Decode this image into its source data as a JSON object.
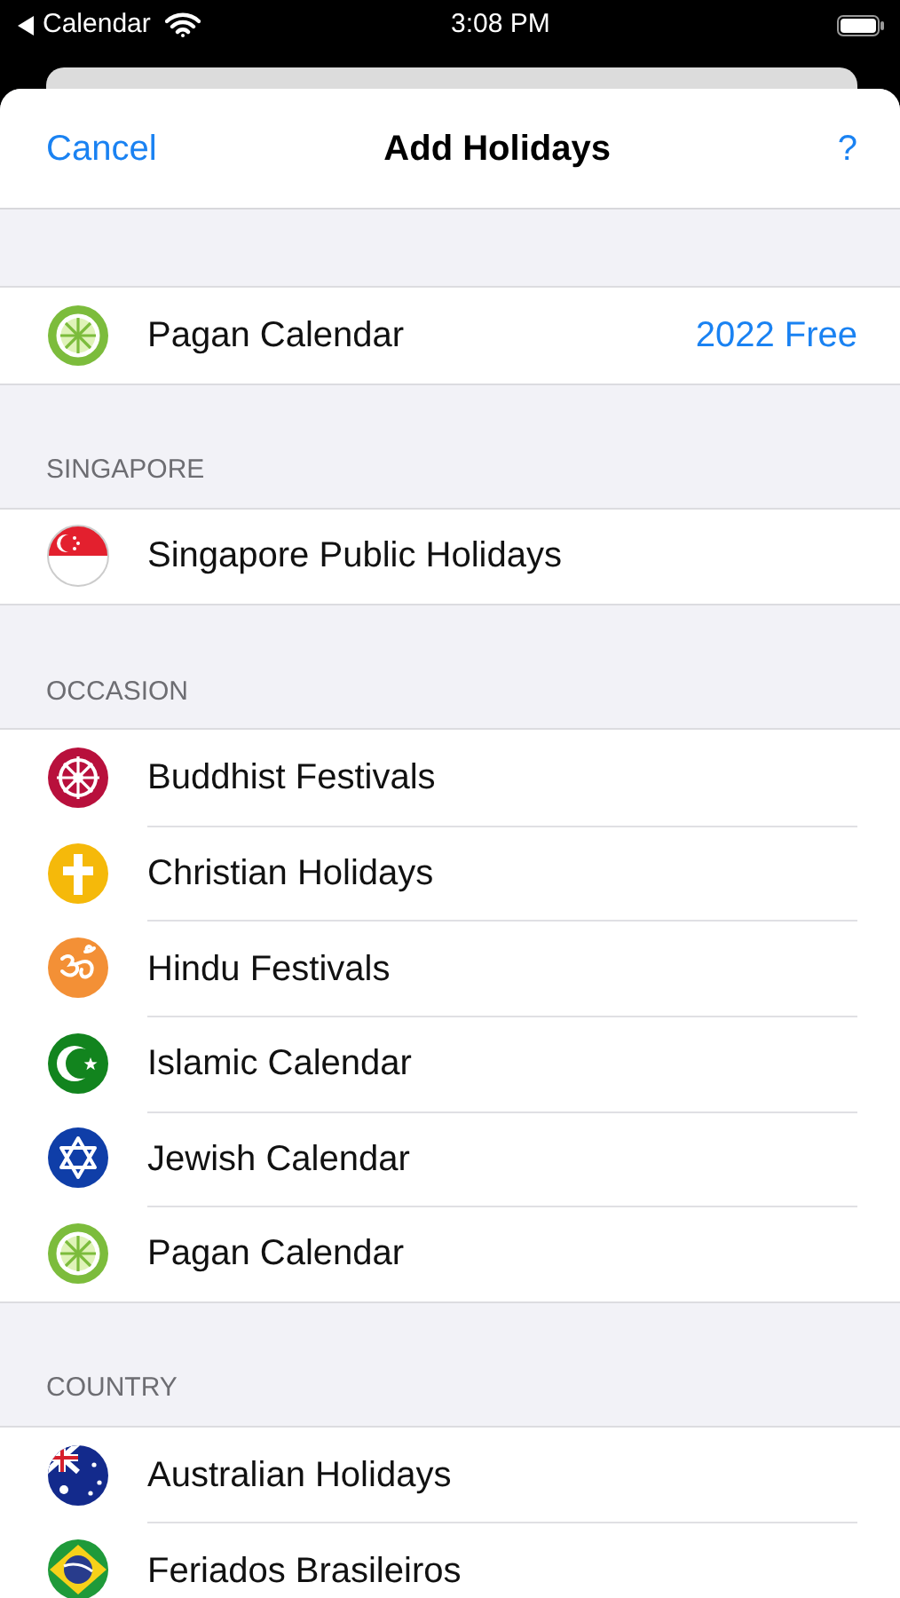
{
  "status_bar": {
    "back_app": "Calendar",
    "time": "3:08 PM"
  },
  "nav": {
    "cancel": "Cancel",
    "title": "Add Holidays",
    "help": "?"
  },
  "sections": [
    {
      "rows": [
        {
          "kind": "pagan",
          "label": "Pagan Calendar",
          "detail": "2022 Free"
        }
      ]
    },
    {
      "header": "SINGAPORE",
      "rows": [
        {
          "kind": "flag-sg",
          "label": "Singapore Public Holidays"
        }
      ]
    },
    {
      "header": "OCCASION",
      "rows": [
        {
          "kind": "dharma",
          "label": "Buddhist Festivals"
        },
        {
          "kind": "cross",
          "label": "Christian Holidays"
        },
        {
          "kind": "om",
          "label": "Hindu Festivals"
        },
        {
          "kind": "crescent",
          "label": "Islamic Calendar"
        },
        {
          "kind": "star",
          "label": "Jewish Calendar"
        },
        {
          "kind": "pagan",
          "label": "Pagan Calendar"
        }
      ]
    },
    {
      "header": "COUNTRY",
      "rows": [
        {
          "kind": "flag-au",
          "label": "Australian Holidays"
        },
        {
          "kind": "flag-br",
          "label": "Feriados Brasileiros"
        }
      ]
    }
  ]
}
